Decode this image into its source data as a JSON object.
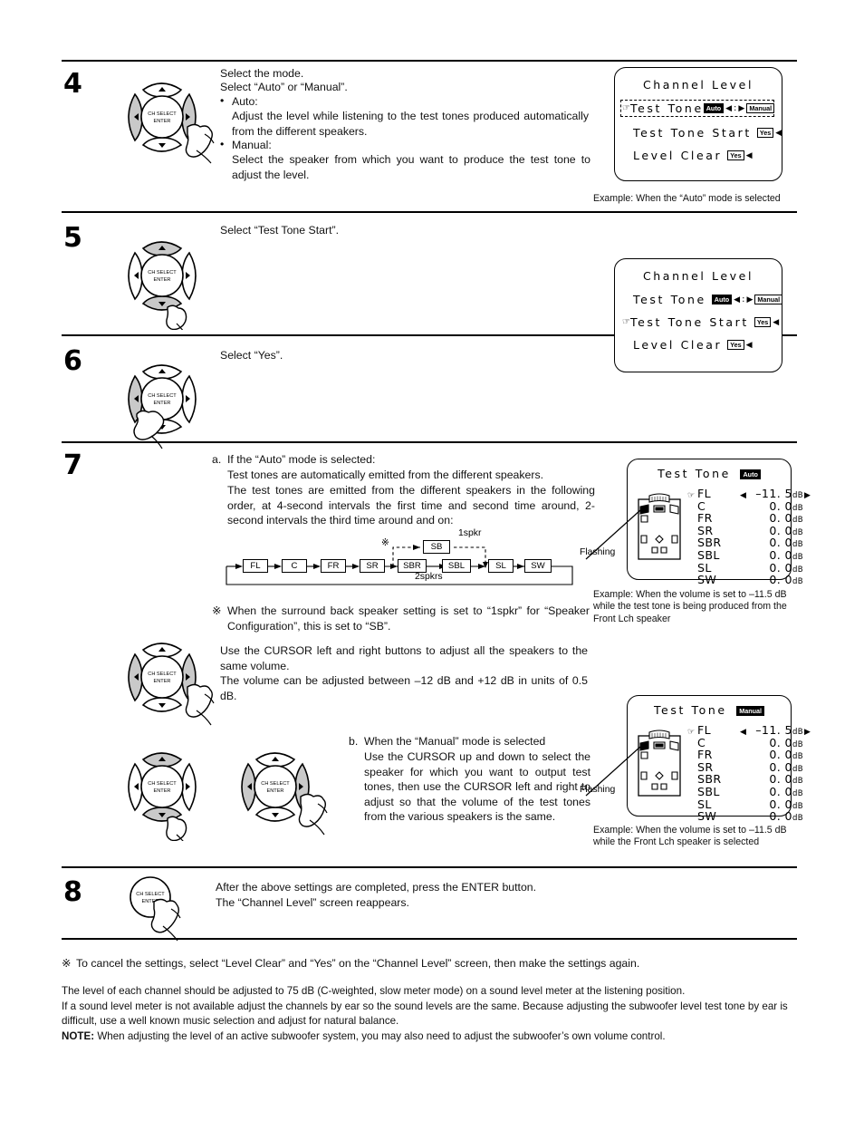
{
  "steps": {
    "s4": {
      "number": "4",
      "lines": [
        "Select the mode.",
        "Select “Auto” or “Manual”."
      ],
      "bullets": [
        {
          "head": "Auto:",
          "body": "Adjust the level while listening to the test tones produced automatically from the different speakers."
        },
        {
          "head": "Manual:",
          "body": "Select the speaker from which you want to produce the test tone to adjust the level."
        }
      ]
    },
    "s5": {
      "number": "5",
      "text": "Select “Test Tone Start”."
    },
    "s6": {
      "number": "6",
      "text": "Select “Yes”."
    },
    "s7": {
      "number": "7",
      "a_label": "a.",
      "a_title": "If the “Auto” mode is selected:",
      "a_line1": "Test tones are automatically emitted from the different speakers.",
      "a_line2": "The test tones are emitted from the different speakers in the following order, at 4-second intervals the first time and second time around, 2-second intervals the third time around and on:",
      "note_mark": "※",
      "note_text": "When the surround back speaker setting is set to “1spkr” for “Speaker Configuration”, this is set to “SB”.",
      "cursor_text1": "Use the CURSOR left and right buttons to adjust all the speakers to the same volume.",
      "cursor_text2": "The volume can be adjusted between –12 dB and +12 dB in units of 0.5 dB.",
      "b_label": "b.",
      "b_title": "When the “Manual” mode is selected",
      "b_body": "Use the CURSOR up and down to select the speaker for which you want to output test tones, then use the CURSOR left and right to adjust so that the volume of the test tones from the various speakers is the same."
    },
    "s8": {
      "number": "8",
      "line1": "After the above settings are completed, press the ENTER button.",
      "line2": "The “Channel Level” screen reappears."
    }
  },
  "pad": {
    "center_line1": "CH SELECT",
    "center_line2": "ENTER"
  },
  "flow": {
    "boxes": [
      "FL",
      "C",
      "FR",
      "SR",
      "SBR",
      "SBL",
      "SL",
      "SW"
    ],
    "sb_box": "SB",
    "label_1spkr": "1spkr",
    "label_2spkrs": "2spkrs",
    "mark": "※"
  },
  "osd_channel_level": {
    "title": "Channel Level",
    "rows": [
      {
        "label": "Test Tone",
        "type": "mode",
        "left_badge": "Auto",
        "right_badge": "Manual",
        "left_arrow": "◀",
        "colon": ":",
        "right_arrow": "▶"
      },
      {
        "label": "Test Tone Start",
        "type": "yes",
        "badge": "Yes",
        "arrow": "◀"
      },
      {
        "label": "Level Clear",
        "type": "yes",
        "badge": "Yes",
        "arrow": "◀"
      }
    ],
    "cursor_glyph": "☞"
  },
  "osd_panels": {
    "step4": {
      "selected_row": 0,
      "dashed_row": 0,
      "caption": "Example: When the “Auto” mode is selected"
    },
    "step5": {
      "selected_row": 1,
      "dashed_row": -1,
      "caption": ""
    }
  },
  "test_tone": {
    "title": "Test Tone",
    "flashing_label": "Flashing",
    "cursor_glyph": "☞",
    "left_arrow": "◀",
    "right_arrow": "▶",
    "db_unit": "dB",
    "channels": [
      {
        "name": "FL",
        "value": "–11. 5",
        "selected": true
      },
      {
        "name": "C",
        "value": "0. 0",
        "selected": false
      },
      {
        "name": "FR",
        "value": "0. 0",
        "selected": false
      },
      {
        "name": "SR",
        "value": "0. 0",
        "selected": false
      },
      {
        "name": "SBR",
        "value": "0. 0",
        "selected": false
      },
      {
        "name": "SBL",
        "value": "0. 0",
        "selected": false
      },
      {
        "name": "SL",
        "value": "0. 0",
        "selected": false
      },
      {
        "name": "SW",
        "value": "0. 0",
        "selected": false
      }
    ],
    "auto": {
      "mode_badge": "Auto",
      "caption_head": "Example:",
      "caption_body": "When the volume is set to –11.5 dB while the test tone is being produced from the Front Lch speaker"
    },
    "manual": {
      "mode_badge": "Manual",
      "caption_head": "Example:",
      "caption_body": "When the volume is set to –11.5 dB while the Front Lch speaker is selected"
    }
  },
  "footnote": {
    "mark": "※",
    "text": "To cancel the settings, select “Level Clear” and “Yes” on the “Channel Level” screen, then make the settings again."
  },
  "bottom": {
    "line1": "The level of each channel should be adjusted to 75 dB (C-weighted, slow meter mode) on a sound level meter at the listening position.",
    "line2": "If a sound level meter is not available adjust the channels by ear so the sound levels are the same. Because adjusting the subwoofer level test tone by ear is difficult, use a well known music selection and adjust for natural balance.",
    "note_label": "NOTE:",
    "note_text": "When adjusting the level of an active subwoofer system, you may also need to adjust the subwoofer’s own volume control."
  }
}
